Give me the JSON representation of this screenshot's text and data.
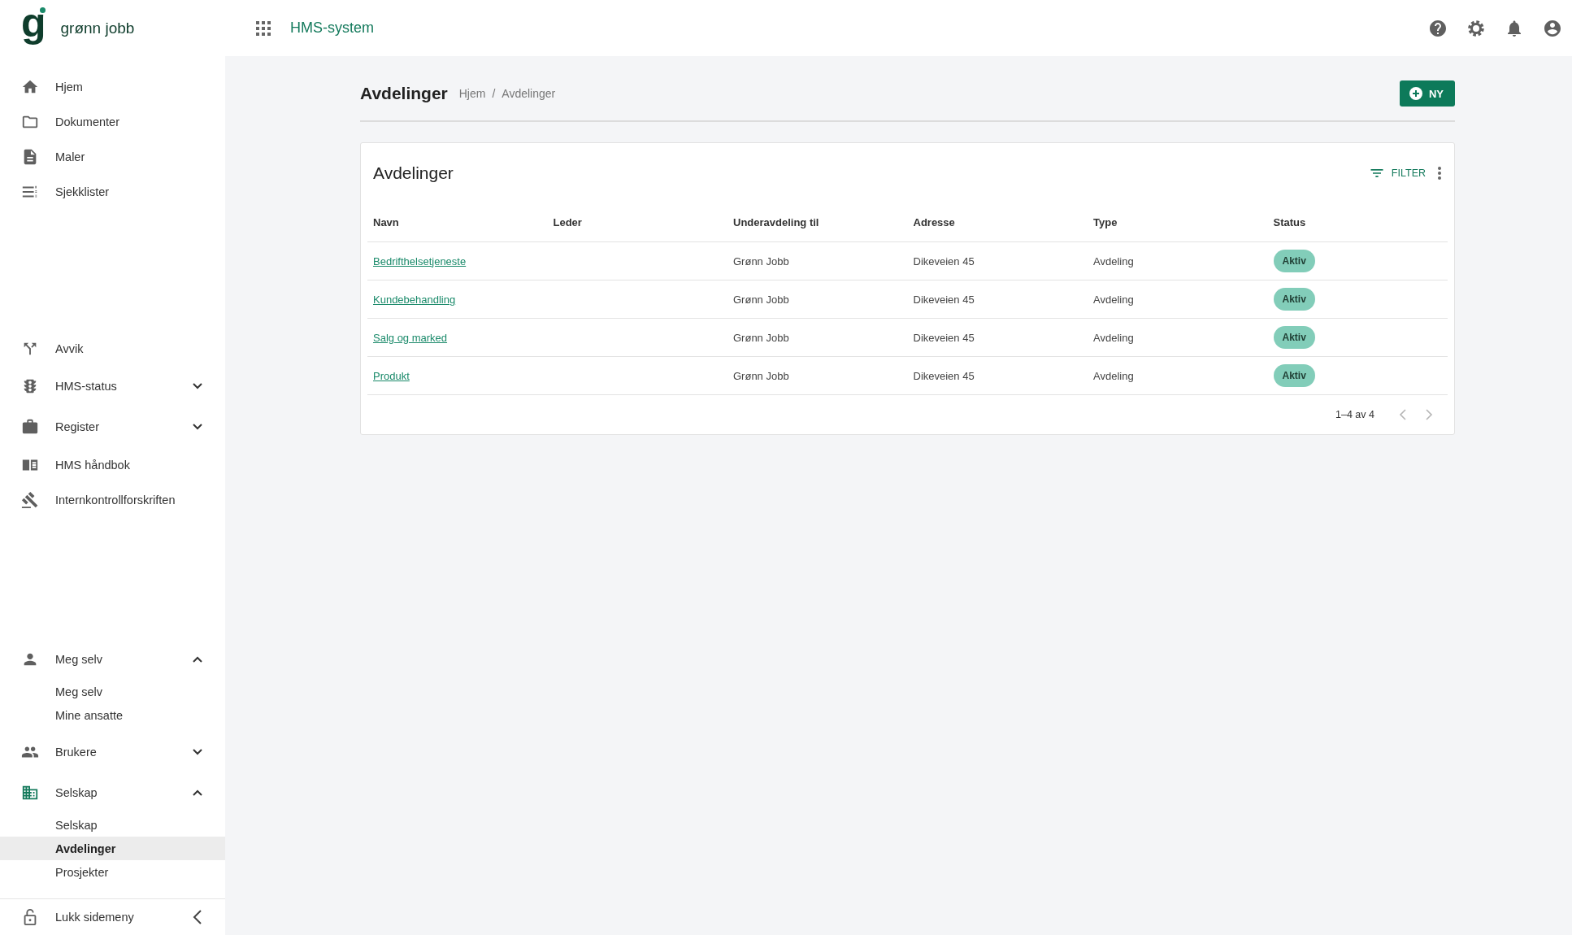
{
  "header": {
    "logo_mark": "g",
    "logo_text": "grønn jobb",
    "app_title": "HMS-system"
  },
  "sidebar": {
    "groups": [
      [
        {
          "label": "Hjem",
          "selected": false
        },
        {
          "label": "Dokumenter",
          "selected": false
        },
        {
          "label": "Maler",
          "selected": false
        },
        {
          "label": "Sjekklister",
          "selected": false
        }
      ],
      [
        {
          "label": "Avvik",
          "selected": false
        },
        {
          "label": "HMS-status",
          "selected": false,
          "expanded": false
        },
        {
          "label": "Register",
          "selected": false,
          "expanded": false
        },
        {
          "label": "HMS håndbok",
          "selected": false
        },
        {
          "label": "Internkontrollforskriften",
          "selected": false
        }
      ],
      [
        {
          "label": "Meg selv",
          "selected": false,
          "expanded": true,
          "children": [
            {
              "label": "Meg selv",
              "selected": false
            },
            {
              "label": "Mine ansatte",
              "selected": false
            }
          ]
        },
        {
          "label": "Brukere",
          "selected": false,
          "expanded": false
        },
        {
          "label": "Selskap",
          "selected": true,
          "expanded": true,
          "children": [
            {
              "label": "Selskap",
              "selected": false
            },
            {
              "label": "Avdelinger",
              "selected": true
            },
            {
              "label": "Prosjekter",
              "selected": false
            }
          ]
        }
      ]
    ],
    "footer": {
      "label": "Lukk sidemeny"
    }
  },
  "page": {
    "title": "Avdelinger",
    "breadcrumb": [
      "Hjem",
      "Avdelinger"
    ],
    "breadcrumb_separator": "/",
    "new_button": "NY"
  },
  "card": {
    "title": "Avdelinger",
    "filter_button": "FILTER",
    "table": {
      "columns": [
        "Navn",
        "Leder",
        "Underavdeling til",
        "Adresse",
        "Type",
        "Status"
      ],
      "rows": [
        {
          "name": "Bedrifthelsetjeneste",
          "parent": "Grønn Jobb",
          "address": "Dikeveien 45",
          "type": "Avdeling",
          "status": "Aktiv"
        },
        {
          "name": "Kundebehandling",
          "parent": "Grønn Jobb",
          "address": "Dikeveien 45",
          "type": "Avdeling",
          "status": "Aktiv"
        },
        {
          "name": "Salg og marked",
          "parent": "Grønn Jobb",
          "address": "Dikeveien 45",
          "type": "Avdeling",
          "status": "Aktiv"
        },
        {
          "name": "Produkt",
          "parent": "Grønn Jobb",
          "address": "Dikeveien 45",
          "type": "Avdeling",
          "status": "Aktiv"
        }
      ]
    },
    "pagination": {
      "range": "1–4 av 4",
      "prev_disabled": true,
      "next_disabled": true
    }
  }
}
